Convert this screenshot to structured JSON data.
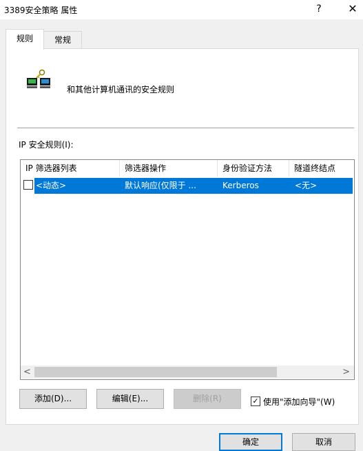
{
  "window": {
    "title": "3389安全策略 属性",
    "help_glyph": "?",
    "close_glyph": "✕"
  },
  "tabs": [
    {
      "label": "规则",
      "active": true
    },
    {
      "label": "常规",
      "active": false
    }
  ],
  "description": "和其他计算机通讯的安全规则",
  "rules_label": "IP 安全规则(I):",
  "table": {
    "columns": [
      "IP 筛选器列表",
      "筛选器操作",
      "身份验证方法",
      "隧道终结点"
    ],
    "rows": [
      {
        "checked": false,
        "cells": [
          "<动态>",
          "默认响应(仅限于 ...",
          "Kerberos",
          "<无>"
        ]
      }
    ]
  },
  "scrollbar": {
    "left_arrow": "<",
    "right_arrow": ">"
  },
  "buttons": {
    "add": "添加(D)...",
    "edit": "编辑(E)...",
    "remove": "删除(R)"
  },
  "wizard": {
    "label": "使用\"添加向导\"(W)",
    "checked": true,
    "check_glyph": "✓"
  },
  "footer": {
    "ok": "确定",
    "cancel": "取消"
  },
  "colors": {
    "selection": "#0078d7",
    "default_button_border": "#0078d7"
  },
  "icons": {
    "network": "network-computers-icon"
  }
}
